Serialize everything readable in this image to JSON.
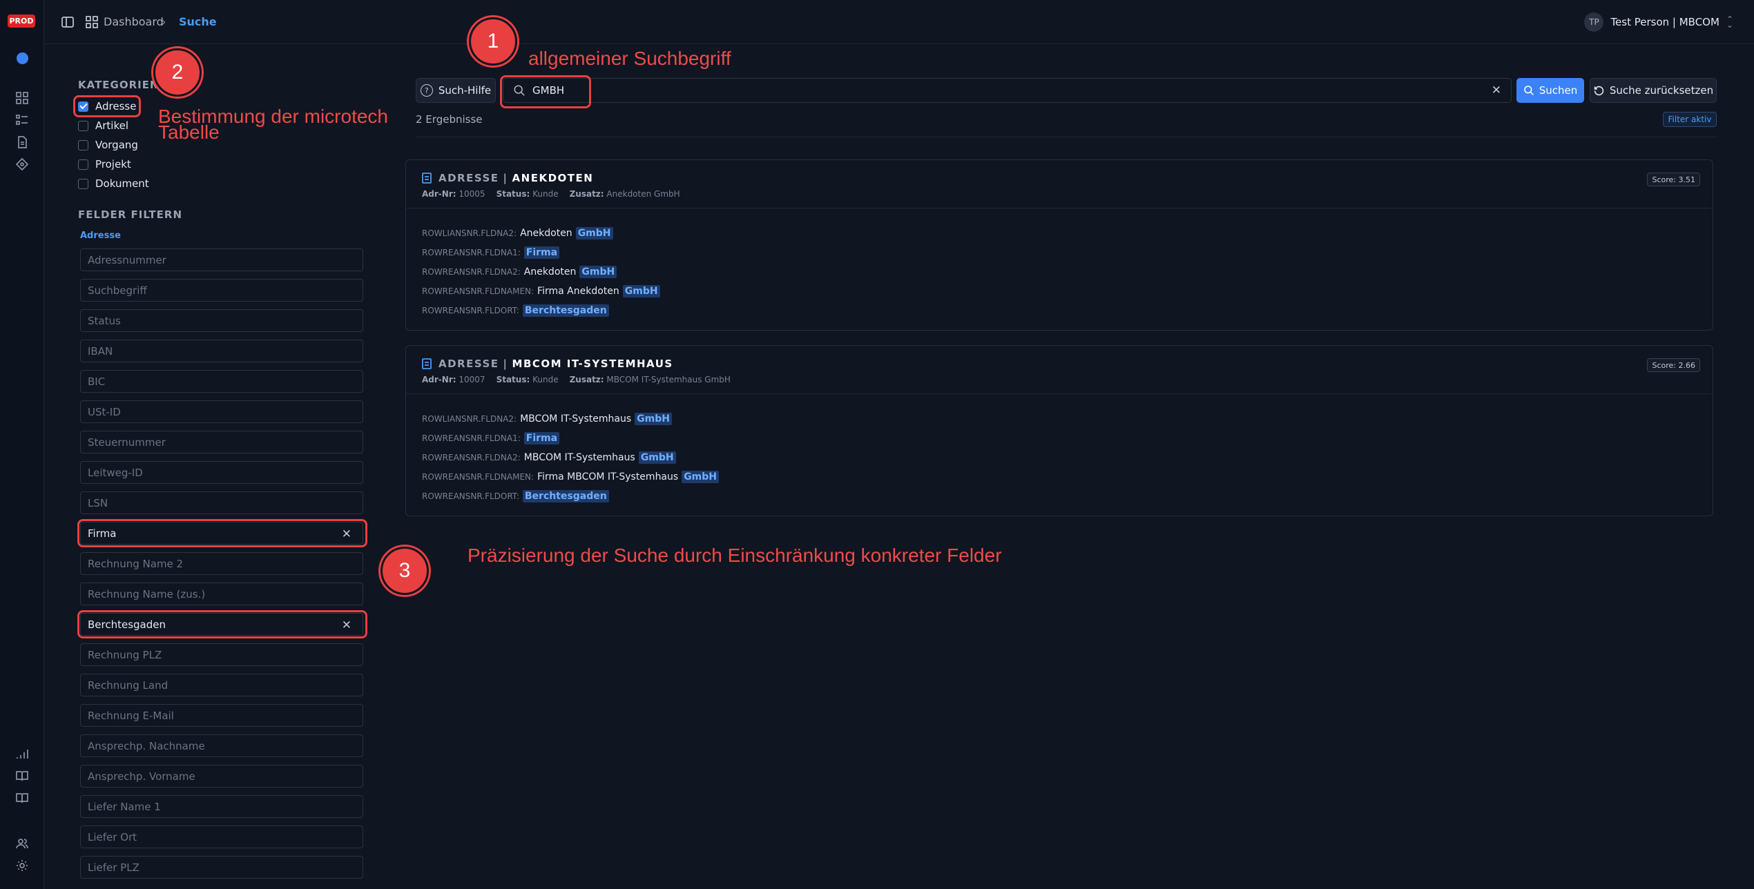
{
  "rail": {
    "prod_badge": "PROD"
  },
  "header": {
    "breadcrumb_home": "Dashboard",
    "breadcrumb_current": "Suche",
    "user_initials": "TP",
    "user_name": "Test Person | MBCOM"
  },
  "filters": {
    "categories_heading": "KATEGORIEN",
    "categories": [
      {
        "label": "Adresse",
        "checked": true
      },
      {
        "label": "Artikel",
        "checked": false
      },
      {
        "label": "Vorgang",
        "checked": false
      },
      {
        "label": "Projekt",
        "checked": false
      },
      {
        "label": "Dokument",
        "checked": false
      }
    ],
    "fields_heading": "FELDER FILTERN",
    "fields_subheading": "Adresse",
    "fields": [
      {
        "placeholder": "Adressnummer",
        "value": ""
      },
      {
        "placeholder": "Suchbegriff",
        "value": ""
      },
      {
        "placeholder": "Status",
        "value": ""
      },
      {
        "placeholder": "IBAN",
        "value": ""
      },
      {
        "placeholder": "BIC",
        "value": ""
      },
      {
        "placeholder": "USt-ID",
        "value": ""
      },
      {
        "placeholder": "Steuernummer",
        "value": ""
      },
      {
        "placeholder": "Leitweg-ID",
        "value": ""
      },
      {
        "placeholder": "LSN",
        "value": ""
      },
      {
        "placeholder": "",
        "value": "Firma"
      },
      {
        "placeholder": "Rechnung Name 2",
        "value": ""
      },
      {
        "placeholder": "Rechnung Name (zus.)",
        "value": ""
      },
      {
        "placeholder": "",
        "value": "Berchtesgaden"
      },
      {
        "placeholder": "Rechnung PLZ",
        "value": ""
      },
      {
        "placeholder": "Rechnung Land",
        "value": ""
      },
      {
        "placeholder": "Rechnung E-Mail",
        "value": ""
      },
      {
        "placeholder": "Ansprechp. Nachname",
        "value": ""
      },
      {
        "placeholder": "Ansprechp. Vorname",
        "value": ""
      },
      {
        "placeholder": "Liefer Name 1",
        "value": ""
      },
      {
        "placeholder": "Liefer Ort",
        "value": ""
      },
      {
        "placeholder": "Liefer PLZ",
        "value": ""
      }
    ]
  },
  "search": {
    "help_label": "Such-Hilfe",
    "query": "GMBH",
    "search_label": "Suchen",
    "reset_label": "Suche zurücksetzen",
    "results_count": "2 Ergebnisse",
    "filter_badge": "Filter aktiv"
  },
  "results": [
    {
      "type": "ADRESSE",
      "name": "ANEKDOTEN",
      "adr_label": "Adr-Nr:",
      "adr": "10005",
      "status_label": "Status:",
      "status": "Kunde",
      "zusatz_label": "Zusatz:",
      "zusatz": "Anekdoten GmbH",
      "score": "Score: 3.51",
      "hits": [
        {
          "key": "ROWLIANSNR.FLDNA2:",
          "text": "Anekdoten",
          "hl": "GmbH"
        },
        {
          "key": "ROWREANSNR.FLDNA1:",
          "text": "",
          "hl": "Firma"
        },
        {
          "key": "ROWREANSNR.FLDNA2:",
          "text": "Anekdoten",
          "hl": "GmbH"
        },
        {
          "key": "ROWREANSNR.FLDNAMEN:",
          "text": "Firma Anekdoten",
          "hl": "GmbH"
        },
        {
          "key": "ROWREANSNR.FLDORT:",
          "text": "",
          "hl": "Berchtesgaden"
        }
      ]
    },
    {
      "type": "ADRESSE",
      "name": "MBCOM IT-SYSTEMHAUS",
      "adr_label": "Adr-Nr:",
      "adr": "10007",
      "status_label": "Status:",
      "status": "Kunde",
      "zusatz_label": "Zusatz:",
      "zusatz": "MBCOM IT-Systemhaus GmbH",
      "score": "Score: 2.66",
      "hits": [
        {
          "key": "ROWLIANSNR.FLDNA2:",
          "text": "MBCOM IT-Systemhaus",
          "hl": "GmbH"
        },
        {
          "key": "ROWREANSNR.FLDNA1:",
          "text": "",
          "hl": "Firma"
        },
        {
          "key": "ROWREANSNR.FLDNA2:",
          "text": "MBCOM IT-Systemhaus",
          "hl": "GmbH"
        },
        {
          "key": "ROWREANSNR.FLDNAMEN:",
          "text": "Firma MBCOM IT-Systemhaus",
          "hl": "GmbH"
        },
        {
          "key": "ROWREANSNR.FLDORT:",
          "text": "",
          "hl": "Berchtesgaden"
        }
      ]
    }
  ],
  "annotations": {
    "n1": "1",
    "t1": "allgemeiner Suchbegriff",
    "n2": "2",
    "t2_line1": "Bestimmung der microtech",
    "t2_line2": "Tabelle",
    "n3": "3",
    "t3": "Präzisierung der Suche durch Einschränkung konkreter Felder"
  },
  "colors": {
    "accent": "#3b82f6",
    "annotation": "#e84040",
    "prod_badge": "#dc2626",
    "highlight_bg": "#1e3a6b"
  }
}
